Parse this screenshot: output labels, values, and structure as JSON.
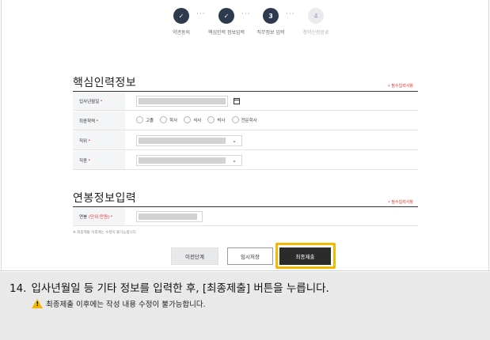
{
  "stepper": {
    "steps": [
      {
        "label": "약관동의",
        "state": "done",
        "mark": "✓"
      },
      {
        "label": "핵심인력 정보입력",
        "state": "done",
        "mark": "✓"
      },
      {
        "label": "직무정보 입력",
        "state": "current",
        "mark": "3"
      },
      {
        "label": "청약신청완료",
        "state": "todo",
        "mark": "4"
      }
    ],
    "dots": "···"
  },
  "section1": {
    "title": "핵심인력정보",
    "required_note": "• 필수입력사항",
    "fields": [
      {
        "label": "입사년월일",
        "type": "date",
        "value": ""
      },
      {
        "label": "최종학력",
        "type": "radio",
        "options": [
          "고졸",
          "학사",
          "석사",
          "박사",
          "전문학사"
        ],
        "selected": null
      },
      {
        "label": "직위",
        "type": "select",
        "value": ""
      },
      {
        "label": "직종",
        "type": "select",
        "value": ""
      }
    ],
    "required_star": "•"
  },
  "section2": {
    "title": "연봉정보입력",
    "required_note": "• 필수입력사항",
    "salary_label": "연봉",
    "salary_unit": "(단위:만원)",
    "salary_value": "",
    "footnote": "※ 최종제출 이후에는 수정이 불가능합니다."
  },
  "buttons": {
    "prev": "이전단계",
    "temp_save": "임시저장",
    "final_submit": "최종제출"
  },
  "instruction": {
    "number": "14.",
    "text": "입사년월일 등 기타 정보를 입력한 후, [최종제출] 버튼을 누릅니다.",
    "warning": "최종제출 이후에는 작성 내용 수정이 불가능합니다."
  },
  "colors": {
    "accent_red": "#e0352b",
    "highlight": "#f5b800",
    "step_dark": "#2e3b4e",
    "warning_yellow": "#f2b705"
  }
}
